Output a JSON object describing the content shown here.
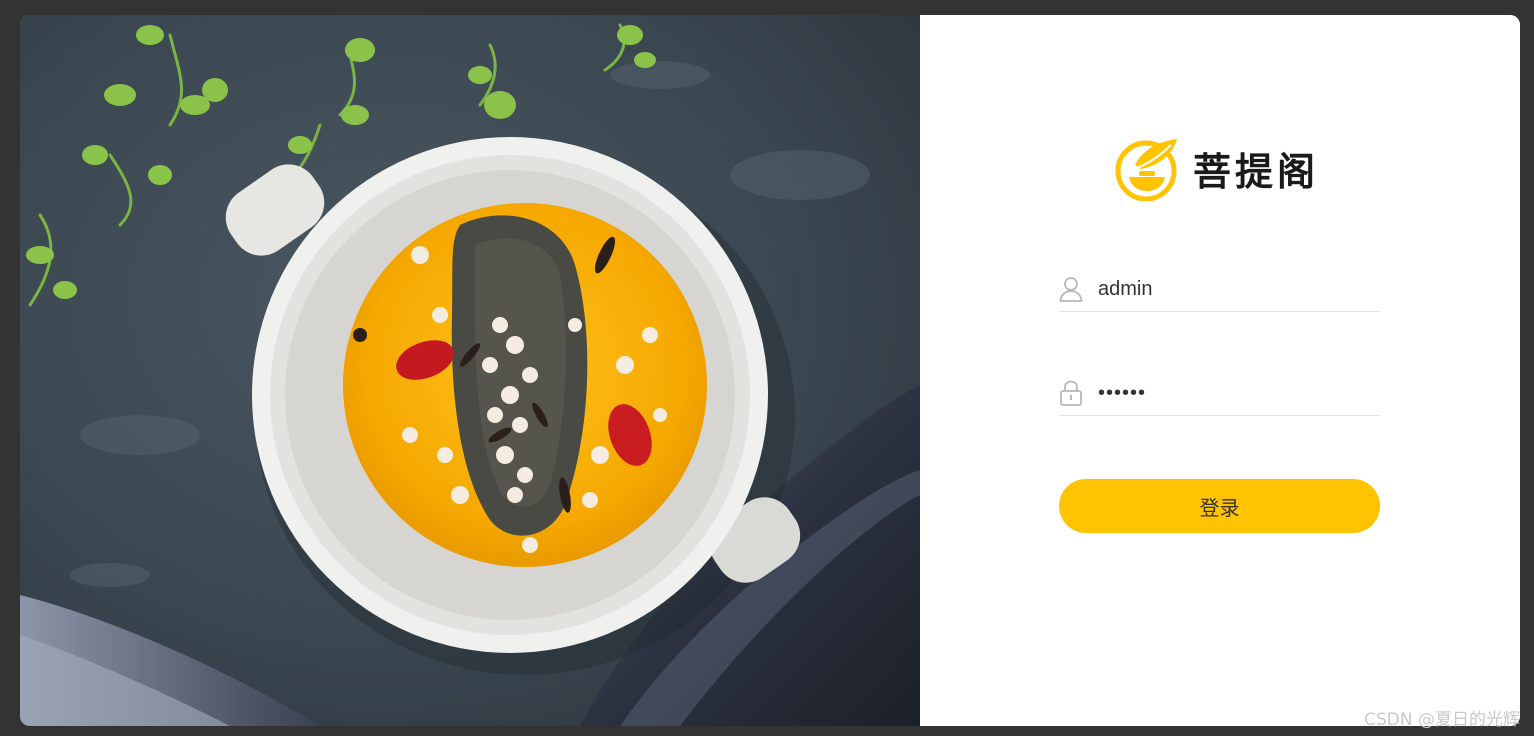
{
  "brand": {
    "name": "菩提阁",
    "logo_color": "#ffc300"
  },
  "login": {
    "username_value": "admin",
    "password_value": "123456",
    "submit_label": "登录",
    "user_icon": "user-icon",
    "lock_icon": "lock-icon"
  },
  "photo": {
    "subject": "food-photo"
  },
  "watermark": "CSDN @夏日的光辉",
  "colors": {
    "accent": "#ffc300",
    "background": "#333333",
    "panel": "#ffffff"
  }
}
